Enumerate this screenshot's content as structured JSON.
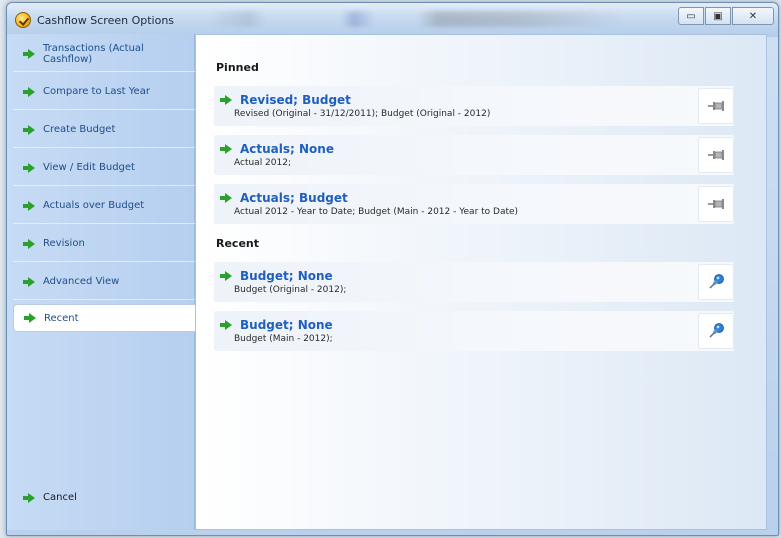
{
  "window": {
    "title": "Cashflow Screen Options",
    "controls": {
      "minimize": "▭",
      "maximize": "▣",
      "close": "✕"
    }
  },
  "sidebar": {
    "items": [
      {
        "label": "Transactions (Actual Cashflow)",
        "active": false
      },
      {
        "label": "Compare to Last Year",
        "active": false
      },
      {
        "label": "Create Budget",
        "active": false
      },
      {
        "label": "View / Edit Budget",
        "active": false
      },
      {
        "label": "Actuals over Budget",
        "active": false
      },
      {
        "label": "Revision",
        "active": false
      },
      {
        "label": "Advanced View",
        "active": false
      },
      {
        "label": "Recent",
        "active": true
      }
    ],
    "cancel_label": "Cancel",
    "arrow_icon": "green-arrow-icon",
    "arrow_color": "#2aa12a"
  },
  "main": {
    "pinned_heading": "Pinned",
    "recent_heading": "Recent",
    "pinned": [
      {
        "title": "Revised; Budget",
        "subtitle": "Revised (Original - 31/12/2011); Budget (Original - 2012)",
        "pin_icon": "unpin-icon"
      },
      {
        "title": "Actuals; None",
        "subtitle": "Actual 2012;",
        "pin_icon": "unpin-icon"
      },
      {
        "title": "Actuals; Budget",
        "subtitle": "Actual 2012 - Year to Date; Budget (Main - 2012 - Year to Date)",
        "pin_icon": "unpin-icon"
      }
    ],
    "recent": [
      {
        "title": "Budget; None",
        "subtitle": "Budget (Original - 2012);",
        "pin_icon": "pushpin-icon"
      },
      {
        "title": "Budget; None",
        "subtitle": "Budget (Main - 2012);",
        "pin_icon": "pushpin-icon"
      }
    ],
    "title_color": "#1f5fbf"
  }
}
